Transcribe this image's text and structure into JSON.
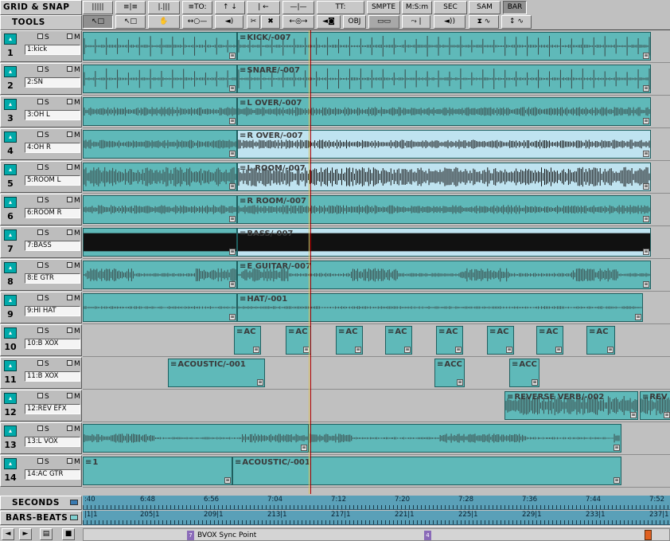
{
  "toolbar": {
    "title_grid": "GRID & SNAP",
    "title_tools": "TOOLS",
    "row1": [
      {
        "label": "|||||",
        "icon": "grid-bars-icon"
      },
      {
        "label": "≡|≡",
        "icon": "grid-lines-icon"
      },
      {
        "label": "|.|||",
        "icon": "grid-ticks-icon"
      },
      {
        "label": "≡TO:",
        "icon": "snap-to-icon"
      },
      {
        "label": "↑ ↓",
        "icon": "snap-arrows-icon"
      },
      {
        "label": "| ←",
        "icon": "snap-left-icon"
      },
      {
        "label": "—|—",
        "icon": "snap-center-icon"
      },
      {
        "label": "TT:",
        "icon": "time-type-icon"
      },
      {
        "label": "SMPTE",
        "icon": "smpte-mode"
      },
      {
        "label": "M:S:m",
        "icon": "mins-secs-mode"
      },
      {
        "label": "SEC",
        "icon": "seconds-mode"
      },
      {
        "label": "SAM",
        "icon": "samples-mode"
      },
      {
        "label": "BAR",
        "icon": "bars-mode"
      }
    ],
    "row2": [
      {
        "label": "↖□",
        "icon": "select-tool-icon"
      },
      {
        "label": "↖□",
        "icon": "range-select-icon"
      },
      {
        "label": "✋",
        "icon": "hand-tool-icon"
      },
      {
        "label": "↔○—",
        "icon": "scrub-tool-icon"
      },
      {
        "label": "◄)",
        "icon": "speaker-icon"
      },
      {
        "label": "✂",
        "icon": "scissors-icon"
      },
      {
        "label": "✖",
        "icon": "erase-icon"
      },
      {
        "label": "←◎→",
        "icon": "zoom-tool-icon"
      },
      {
        "label": "◄◙",
        "icon": "nudge-icon"
      },
      {
        "label": "OBJ",
        "icon": "object-mode"
      },
      {
        "label": "▭▭",
        "icon": "envelope-icon"
      },
      {
        "label": "⤳ |",
        "icon": "fade-icon"
      },
      {
        "label": "◄))",
        "icon": "monitor-icon"
      },
      {
        "label": "⧗ ∿",
        "icon": "timestretch-icon"
      },
      {
        "label": "↕ ∿",
        "icon": "gain-icon"
      }
    ]
  },
  "tracks": [
    {
      "number": "1",
      "name": "1:kick",
      "solo": "S",
      "mute": "M"
    },
    {
      "number": "2",
      "name": "2:SN",
      "solo": "S",
      "mute": "M"
    },
    {
      "number": "3",
      "name": "3:OH L",
      "solo": "S",
      "mute": "M"
    },
    {
      "number": "4",
      "name": "4:OH R",
      "solo": "S",
      "mute": "M"
    },
    {
      "number": "5",
      "name": "5:ROOM L",
      "solo": "S",
      "mute": "M"
    },
    {
      "number": "6",
      "name": "6:ROOM R",
      "solo": "S",
      "mute": "M"
    },
    {
      "number": "7",
      "name": "7:BASS",
      "solo": "S",
      "mute": "M"
    },
    {
      "number": "8",
      "name": "8:E GTR",
      "solo": "S",
      "mute": "M"
    },
    {
      "number": "9",
      "name": "9:HI HAT",
      "solo": "S",
      "mute": "M"
    },
    {
      "number": "10",
      "name": "10:B XOX",
      "solo": "S",
      "mute": "M"
    },
    {
      "number": "11",
      "name": "11:B XOX",
      "solo": "S",
      "mute": "M"
    },
    {
      "number": "12",
      "name": "12:REV EFX",
      "solo": "S",
      "mute": "M"
    },
    {
      "number": "13",
      "name": "13:L VOX",
      "solo": "S",
      "mute": "M"
    },
    {
      "number": "14",
      "name": "14:AC GTR",
      "solo": "S",
      "mute": "M"
    }
  ],
  "clips": [
    {
      "track": 0,
      "label": "",
      "style": "pulse"
    },
    {
      "track": 0,
      "label": "KICK/-007",
      "style": "pulse"
    },
    {
      "track": 1,
      "label": "",
      "style": "pulse"
    },
    {
      "track": 1,
      "label": "SNARE/-007",
      "style": "pulse"
    },
    {
      "track": 2,
      "label": "",
      "style": "dense"
    },
    {
      "track": 2,
      "label": "L OVER/-007",
      "style": "dense"
    },
    {
      "track": 3,
      "label": "",
      "style": "dense"
    },
    {
      "track": 3,
      "label": "R OVER/-007",
      "style": "dense"
    },
    {
      "track": 4,
      "label": "",
      "style": "loud"
    },
    {
      "track": 4,
      "label": "L ROOM/-007",
      "style": "loud"
    },
    {
      "track": 5,
      "label": "",
      "style": "dense"
    },
    {
      "track": 5,
      "label": "R ROOM/-007",
      "style": "dense"
    },
    {
      "track": 6,
      "label": "",
      "style": "solid"
    },
    {
      "track": 6,
      "label": "BASS/-007",
      "style": "solid"
    },
    {
      "track": 7,
      "label": "",
      "style": "phrase"
    },
    {
      "track": 7,
      "label": "E GUITAR/-007",
      "style": "phrase"
    },
    {
      "track": 8,
      "label": "",
      "style": "thin"
    },
    {
      "track": 8,
      "label": "HAT/-001",
      "style": "thin"
    },
    {
      "track": 9,
      "label": "AC",
      "style": "empty"
    },
    {
      "track": 9,
      "label": "AC",
      "style": "empty"
    },
    {
      "track": 9,
      "label": "AC",
      "style": "empty"
    },
    {
      "track": 9,
      "label": "AC",
      "style": "empty"
    },
    {
      "track": 9,
      "label": "AC",
      "style": "empty"
    },
    {
      "track": 9,
      "label": "AC",
      "style": "empty"
    },
    {
      "track": 9,
      "label": "AC",
      "style": "empty"
    },
    {
      "track": 9,
      "label": "AC",
      "style": "empty"
    },
    {
      "track": 10,
      "label": "ACOUSTIC/-001",
      "style": "empty"
    },
    {
      "track": 10,
      "label": "ACC",
      "style": "empty"
    },
    {
      "track": 10,
      "label": "ACC",
      "style": "empty"
    },
    {
      "track": 11,
      "label": "REVERSE VERB/-002",
      "style": "loud"
    },
    {
      "track": 11,
      "label": "REV",
      "style": "loud"
    },
    {
      "track": 12,
      "label": "",
      "style": "vox"
    },
    {
      "track": 12,
      "label": "",
      "style": "vox"
    },
    {
      "track": 13,
      "label": "1",
      "style": "empty"
    },
    {
      "track": 13,
      "label": "ACOUSTIC/-001",
      "style": "empty"
    }
  ],
  "rulers": {
    "seconds_title": "SECONDS",
    "bars_title": "BARS-BEATS",
    "seconds_labels": [
      ":40",
      "6:48",
      "6:56",
      "7:04",
      "7:12",
      "7:20",
      "7:28",
      "7:36",
      "7:44",
      "7:52"
    ],
    "bars_labels": [
      "|1|1",
      "205|1",
      "209|1",
      "213|1",
      "217|1",
      "221|1",
      "225|1",
      "229|1",
      "233|1",
      "237|1"
    ]
  },
  "bottombar": {
    "buttons": [
      {
        "label": "◄",
        "icon": "scroll-left-icon"
      },
      {
        "label": "►",
        "icon": "scroll-right-icon"
      },
      {
        "label": "▤",
        "icon": "trash-icon"
      },
      {
        "label": "■",
        "icon": "marker-icon"
      }
    ],
    "markers": [
      {
        "flag": "7",
        "label": "BVOX Sync Point"
      },
      {
        "flag": "4",
        "label": ""
      }
    ]
  },
  "colors": {
    "clip": "#5fb9b9",
    "clip_light": "#bfe3f0",
    "playhead": "#b00000",
    "ruler": "#5aa0b8"
  }
}
